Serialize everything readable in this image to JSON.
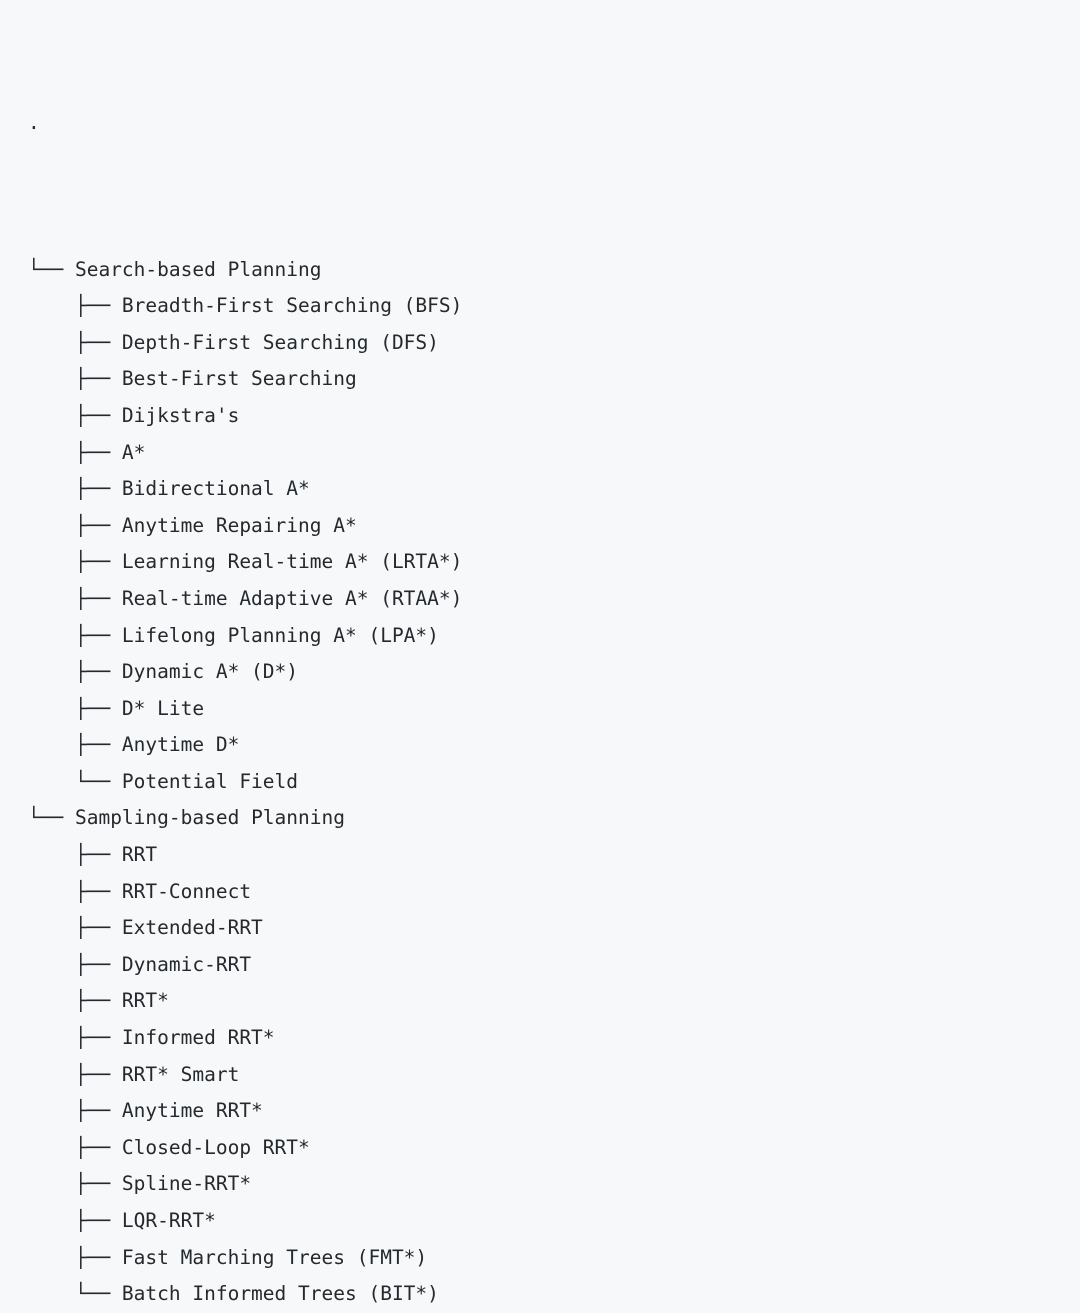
{
  "document": {
    "kind": "ascii-directory-tree",
    "background_color": "#f7f8f9",
    "text_color": "#24292e",
    "root_label": "."
  },
  "tree": {
    "root": ".",
    "nodes": [
      {
        "prefix": "└── ",
        "label": "Search-based Planning",
        "level": 1,
        "last": false
      },
      {
        "prefix": "    ├── ",
        "label": "Breadth-First Searching (BFS)",
        "level": 2,
        "last": false
      },
      {
        "prefix": "    ├── ",
        "label": "Depth-First Searching (DFS)",
        "level": 2,
        "last": false
      },
      {
        "prefix": "    ├── ",
        "label": "Best-First Searching",
        "level": 2,
        "last": false
      },
      {
        "prefix": "    ├── ",
        "label": "Dijkstra's",
        "level": 2,
        "last": false
      },
      {
        "prefix": "    ├── ",
        "label": "A*",
        "level": 2,
        "last": false
      },
      {
        "prefix": "    ├── ",
        "label": "Bidirectional A*",
        "level": 2,
        "last": false
      },
      {
        "prefix": "    ├── ",
        "label": "Anytime Repairing A*",
        "level": 2,
        "last": false
      },
      {
        "prefix": "    ├── ",
        "label": "Learning Real-time A* (LRTA*)",
        "level": 2,
        "last": false
      },
      {
        "prefix": "    ├── ",
        "label": "Real-time Adaptive A* (RTAA*)",
        "level": 2,
        "last": false
      },
      {
        "prefix": "    ├── ",
        "label": "Lifelong Planning A* (LPA*)",
        "level": 2,
        "last": false
      },
      {
        "prefix": "    ├── ",
        "label": "Dynamic A* (D*)",
        "level": 2,
        "last": false
      },
      {
        "prefix": "    ├── ",
        "label": "D* Lite",
        "level": 2,
        "last": false
      },
      {
        "prefix": "    ├── ",
        "label": "Anytime D*",
        "level": 2,
        "last": false
      },
      {
        "prefix": "    └── ",
        "label": "Potential Field",
        "level": 2,
        "last": true
      },
      {
        "prefix": "└── ",
        "label": "Sampling-based Planning",
        "level": 1,
        "last": true
      },
      {
        "prefix": "    ├── ",
        "label": "RRT",
        "level": 2,
        "last": false
      },
      {
        "prefix": "    ├── ",
        "label": "RRT-Connect",
        "level": 2,
        "last": false
      },
      {
        "prefix": "    ├── ",
        "label": "Extended-RRT",
        "level": 2,
        "last": false
      },
      {
        "prefix": "    ├── ",
        "label": "Dynamic-RRT",
        "level": 2,
        "last": false
      },
      {
        "prefix": "    ├── ",
        "label": "RRT*",
        "level": 2,
        "last": false
      },
      {
        "prefix": "    ├── ",
        "label": "Informed RRT*",
        "level": 2,
        "last": false
      },
      {
        "prefix": "    ├── ",
        "label": "RRT* Smart",
        "level": 2,
        "last": false
      },
      {
        "prefix": "    ├── ",
        "label": "Anytime RRT*",
        "level": 2,
        "last": false
      },
      {
        "prefix": "    ├── ",
        "label": "Closed-Loop RRT*",
        "level": 2,
        "last": false
      },
      {
        "prefix": "    ├── ",
        "label": "Spline-RRT*",
        "level": 2,
        "last": false
      },
      {
        "prefix": "    ├── ",
        "label": "LQR-RRT*",
        "level": 2,
        "last": false
      },
      {
        "prefix": "    ├── ",
        "label": "Fast Marching Trees (FMT*)",
        "level": 2,
        "last": false
      },
      {
        "prefix": "    └── ",
        "label": "Batch Informed Trees (BIT*)",
        "level": 2,
        "last": true
      }
    ]
  }
}
